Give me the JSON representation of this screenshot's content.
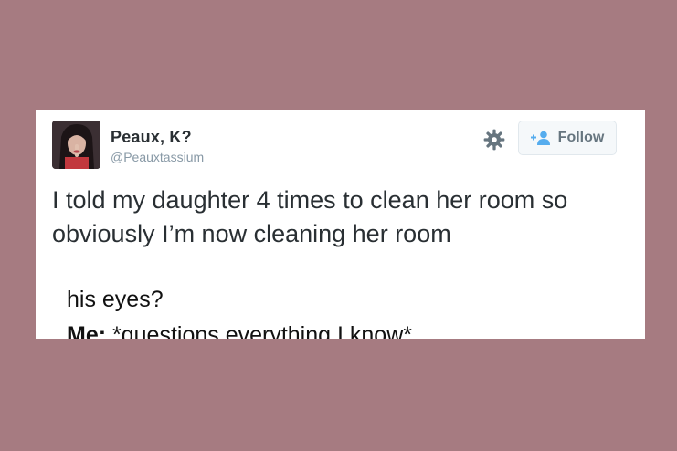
{
  "background_color": "#a67b81",
  "tweet": {
    "display_name": "Peaux, K?",
    "handle": "@Peauxtassium",
    "text": "I told my daughter 4 times to clean her room so obviously I’m now cleaning her room",
    "avatar_icon": "avatar-photo",
    "settings_icon": "gear-icon",
    "follow_icon": "add-user-icon",
    "follow_label": "Follow"
  },
  "overlay": {
    "line1": "his eyes?",
    "line2_prefix": "Me:",
    "line2_rest": " *questions everything I know*"
  }
}
